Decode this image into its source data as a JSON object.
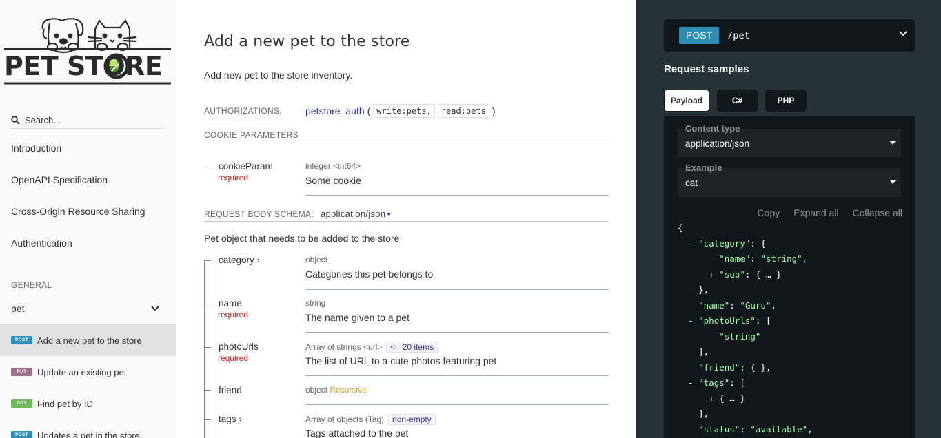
{
  "sidebar": {
    "logo_text": "PET STORE",
    "search_placeholder": "Search...",
    "nav": [
      {
        "label": "Introduction"
      },
      {
        "label": "OpenAPI Specification"
      },
      {
        "label": "Cross-Origin Resource Sharing"
      },
      {
        "label": "Authentication"
      }
    ],
    "group_label": "GENERAL",
    "group": {
      "label": "pet",
      "expanded": true
    },
    "operations": [
      {
        "method": "POST",
        "label": "Add a new pet to the store",
        "color": "#2d8fb8",
        "active": true
      },
      {
        "method": "PUT",
        "label": "Update an existing pet",
        "color": "#9b708b",
        "active": false
      },
      {
        "method": "GET",
        "label": "Find pet by ID",
        "color": "#6bbd5b",
        "active": false
      },
      {
        "method": "POST",
        "label": "Updates a pet in the store",
        "color": "#2d8fb8",
        "active": false
      }
    ]
  },
  "main": {
    "title": "Add a new pet to the store",
    "description": "Add new pet to the store inventory.",
    "authorizations_label": "AUTHORIZATIONS:",
    "auth_name": "petstore_auth",
    "auth_scopes": [
      "write:pets,",
      "read:pets"
    ],
    "auth_open": "(",
    "auth_close": ")",
    "cookie_params_label": "COOKIE PARAMETERS",
    "cookie_param": {
      "name": "cookieParam",
      "required": "required",
      "type": "integer <int64>",
      "description": "Some cookie"
    },
    "body_schema_label": "REQUEST BODY SCHEMA:",
    "body_schema_type": "application/json",
    "body_description": "Pet object that needs to be added to the store",
    "fields": [
      {
        "name": "category",
        "expandable": "›",
        "required": "",
        "type": "object",
        "constraint": "",
        "extra": "",
        "description": "Categories this pet belongs to"
      },
      {
        "name": "name",
        "expandable": "",
        "required": "required",
        "type": "string",
        "constraint": "",
        "extra": "",
        "description": "The name given to a pet"
      },
      {
        "name": "photoUrls",
        "expandable": "",
        "required": "required",
        "type": "Array of strings <url>",
        "constraint": "<= 20 items",
        "extra": "",
        "description": "The list of URL to a cute photos featuring pet"
      },
      {
        "name": "friend",
        "expandable": "",
        "required": "",
        "type": "object",
        "constraint": "",
        "extra": "Recursive",
        "description": ""
      },
      {
        "name": "tags",
        "expandable": "›",
        "required": "",
        "type": "Array of objects (Tag)",
        "constraint": "non-empty",
        "extra": "",
        "description": "Tags attached to the pet"
      }
    ]
  },
  "right": {
    "method": "POST",
    "path": "/pet",
    "request_samples_label": "Request samples",
    "tabs": [
      "Payload",
      "C#",
      "PHP"
    ],
    "content_type_label": "Content type",
    "content_type_value": "application/json",
    "example_label": "Example",
    "example_value": "cat",
    "actions": [
      "Copy",
      "Expand all",
      "Collapse all"
    ],
    "json": {
      "category_name": "\"string\"",
      "name": "\"Guru\"",
      "photo_url": "\"string\"",
      "status": "\"available\""
    }
  }
}
